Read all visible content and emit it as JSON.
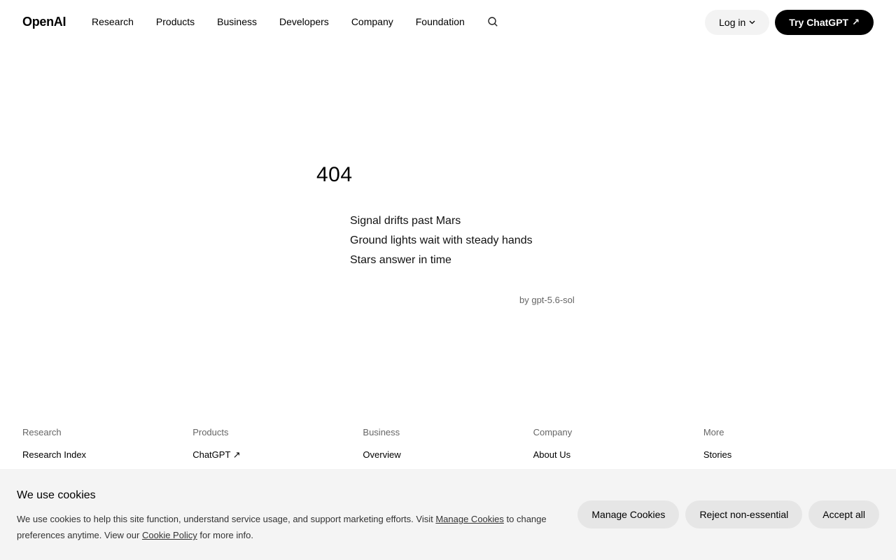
{
  "header": {
    "logo": "OpenAI",
    "nav": [
      "Research",
      "Products",
      "Business",
      "Developers",
      "Company",
      "Foundation"
    ],
    "search_icon": "search-icon",
    "login_label": "Log in",
    "try_label": "Try ChatGPT",
    "try_icon": "↗"
  },
  "main": {
    "code": "404",
    "poem": [
      "Signal drifts past Mars",
      "Ground lights wait with steady hands",
      "Stars answer in time"
    ],
    "byline": "by gpt-5.6-sol"
  },
  "footer": {
    "columns": [
      {
        "heading": "Research",
        "link": "Research Index"
      },
      {
        "heading": "Products",
        "link": "ChatGPT ↗"
      },
      {
        "heading": "Business",
        "link": "Overview"
      },
      {
        "heading": "Company",
        "link": "About Us"
      },
      {
        "heading": "More",
        "link": "Stories"
      }
    ]
  },
  "cookies": {
    "title": "We use cookies",
    "text_1": "We use cookies to help this site function, understand service usage, and support marketing efforts. Visit ",
    "manage_link": "Manage Cookies",
    "text_2": " to change preferences anytime. View our ",
    "policy_link": "Cookie Policy",
    "text_3": " for more info.",
    "buttons": {
      "manage": "Manage Cookies",
      "reject": "Reject non-essential",
      "accept": "Accept all"
    }
  },
  "colors": {
    "accent": "#000000",
    "banner_bg": "#f4f4f4",
    "button_bg": "#e6e6e6"
  }
}
